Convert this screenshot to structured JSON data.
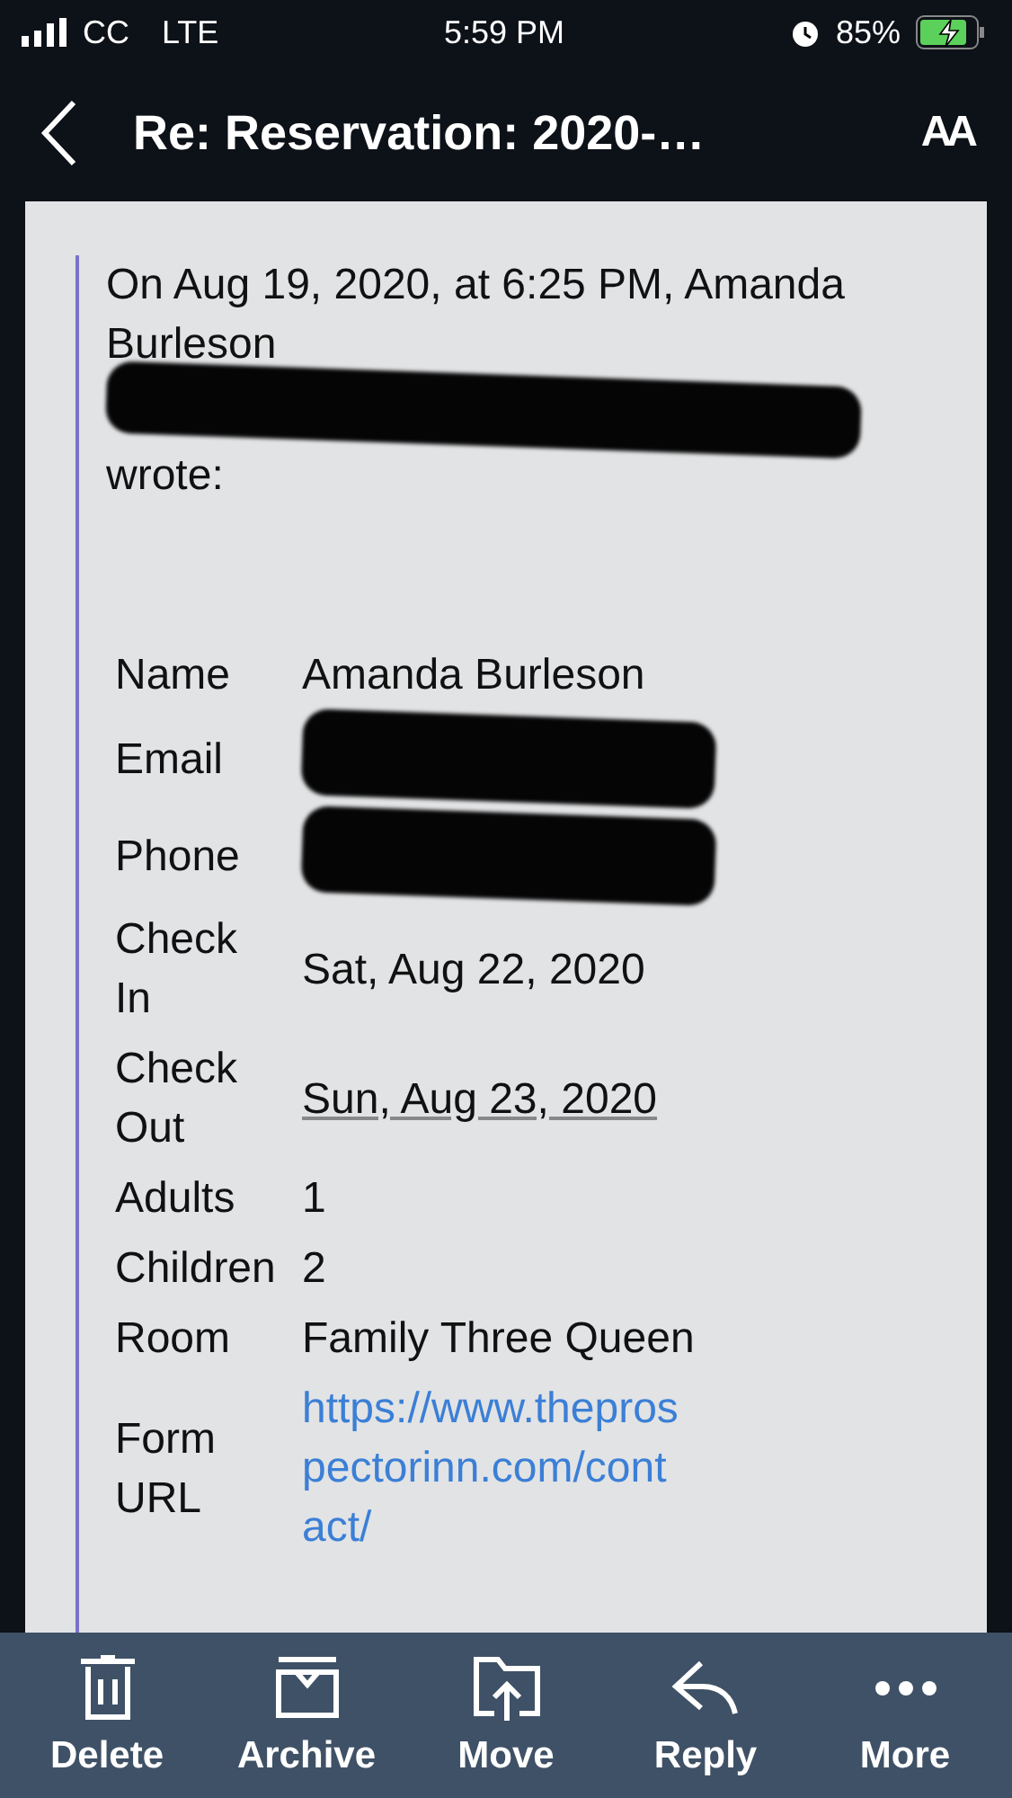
{
  "status_bar": {
    "carrier": "CC",
    "network": "LTE",
    "time": "5:59 PM",
    "battery": "85%",
    "charging": true
  },
  "nav": {
    "title": "Re: Reservation: 2020-…",
    "text_size_button": "AA"
  },
  "quote": {
    "intro": "On Aug 19, 2020, at 6:25 PM, Amanda Burleson",
    "sender_redacted": true,
    "wrote": "wrote:"
  },
  "fields": [
    {
      "label": "Name",
      "kind": "text",
      "value": "Amanda Burleson"
    },
    {
      "label": "Email",
      "kind": "redacted"
    },
    {
      "label": "Phone",
      "kind": "redacted"
    },
    {
      "label": "Check In",
      "kind": "text",
      "value": "Sat, Aug 22, 2020"
    },
    {
      "label": "Check Out",
      "kind": "underlined",
      "value": "Sun, Aug 23, 2020"
    },
    {
      "label": "Adults",
      "kind": "text",
      "value": "1"
    },
    {
      "label": "Children",
      "kind": "text",
      "value": "2"
    },
    {
      "label": "Room",
      "kind": "text",
      "value": "Family Three Queen"
    },
    {
      "label": "Form URL",
      "kind": "link",
      "value": "https://www.theprospectorinn.com/contact/"
    }
  ],
  "toolbar": [
    {
      "kind": "delete",
      "label": "Delete"
    },
    {
      "kind": "archive",
      "label": "Archive"
    },
    {
      "kind": "move",
      "label": "Move"
    },
    {
      "kind": "reply",
      "label": "Reply"
    },
    {
      "kind": "more",
      "label": "More"
    }
  ]
}
